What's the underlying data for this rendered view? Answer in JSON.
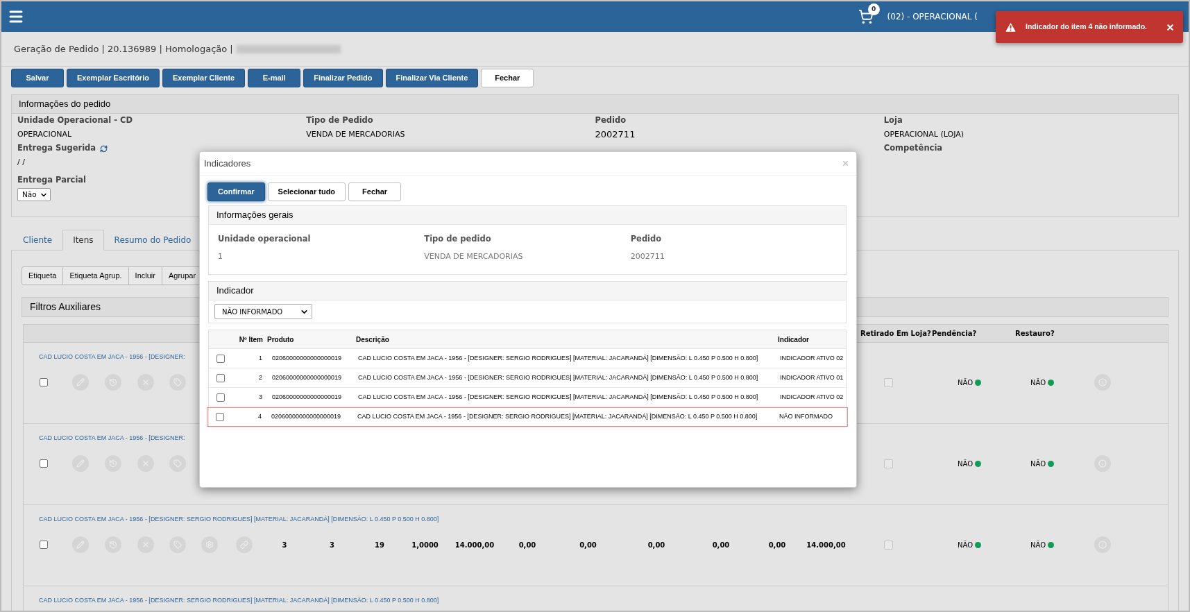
{
  "topbar": {
    "cart_count": "0",
    "user": "(02) - OPERACIONAL ("
  },
  "toast": {
    "message": "Indicador do item 4 não informado."
  },
  "page_title": "Geração de Pedido | 20.136989 | Homologação |",
  "actions": [
    {
      "label": "Salvar",
      "kind": "primary"
    },
    {
      "label": "Exemplar Escritório",
      "kind": "primary"
    },
    {
      "label": "Exemplar Cliente",
      "kind": "primary"
    },
    {
      "label": "E-mail",
      "kind": "primary"
    },
    {
      "label": "Finalizar Pedido",
      "kind": "primary"
    },
    {
      "label": "Finalizar Via Cliente",
      "kind": "primary"
    },
    {
      "label": "Fechar",
      "kind": "default"
    }
  ],
  "order_info": {
    "title": "Informações do pedido",
    "columns": [
      [
        {
          "label": "Unidade Operacional - CD",
          "value": "OPERACIONAL",
          "kind": "text"
        },
        {
          "label": "Entrega Sugerida",
          "value": "/ /",
          "kind": "refresh"
        },
        {
          "label": "Entrega Parcial",
          "value": "Não",
          "kind": "select"
        }
      ],
      [
        {
          "label": "Tipo de Pedido",
          "value": "VENDA DE MERCADORIAS",
          "kind": "text"
        }
      ],
      [
        {
          "label": "Pedido",
          "value": "2002711",
          "kind": "large"
        }
      ],
      [
        {
          "label": "Loja",
          "value": "OPERACIONAL (LOJA)",
          "kind": "text"
        },
        {
          "label": "Competência",
          "kind": "text"
        }
      ]
    ]
  },
  "tabs": [
    {
      "label": "Cliente",
      "selected": false
    },
    {
      "label": "Itens",
      "selected": true
    },
    {
      "label": "Resumo do Pedido",
      "selected": false
    }
  ],
  "items_toolbar": [
    "Etiqueta",
    "Etiqueta Agrup.",
    "Incluir",
    "Agrupar"
  ],
  "filters": {
    "title": "Filtros Auxiliares"
  },
  "items_table": {
    "columns": [
      "Retirado Em Loja?",
      "Pendência?",
      "Restauro?"
    ],
    "rows": [
      {
        "kind": "partial",
        "title": "CAD LUCIO COSTA EM JACA - 1956 - [DESIGNER:",
        "checked": false,
        "picked_up": false,
        "pendencia": {
          "text": "NÃO",
          "color": "#119c55"
        },
        "restauro": {
          "text": "NÃO",
          "color": "#119c55"
        }
      },
      {
        "kind": "partial",
        "title": "CAD LUCIO COSTA EM JACA - 1956 - [DESIGNER:",
        "checked": false,
        "picked_up": false,
        "pendencia": {
          "text": "NÃO",
          "color": "#119c55"
        },
        "restauro": {
          "text": "NÃO",
          "color": "#119c55"
        }
      },
      {
        "kind": "full",
        "title": "CAD LUCIO COSTA EM JACA - 1956 - [DESIGNER: SERGIO RODRIGUES] [MATERIAL: JACARANDÁ] [DIMENSÃO: L 0.450 P 0.500 H 0.800]",
        "checked": false,
        "picked_up": false,
        "values": [
          "3",
          "3",
          "19",
          "1,0000",
          "14.000,00",
          "0,00",
          "0,00",
          "0,00",
          "0,00",
          "0,00",
          "14.000,00"
        ],
        "pendencia": {
          "text": "NÃO",
          "color": "#119c55"
        },
        "restauro": {
          "text": "NÃO",
          "color": "#119c55"
        }
      },
      {
        "kind": "title_only",
        "title": "CAD LUCIO COSTA EM JACA - 1956 - [DESIGNER: SERGIO RODRIGUES] [MATERIAL: JACARANDÁ] [DIMENSÃO: L 0.450 P 0.500 H 0.800]"
      }
    ]
  },
  "modal": {
    "title": "Indicadores",
    "buttons": [
      {
        "label": "Confirmar",
        "kind": "primary"
      },
      {
        "label": "Selecionar tudo",
        "kind": "default"
      },
      {
        "label": "Fechar",
        "kind": "default"
      }
    ],
    "general": {
      "title": "Informações gerais",
      "fields": [
        {
          "label": "Unidade operacional",
          "value": "1"
        },
        {
          "label": "Tipo de pedido",
          "value": "VENDA DE MERCADORIAS"
        },
        {
          "label": "Pedido",
          "value": "2002711"
        }
      ]
    },
    "indicator": {
      "title": "Indicador",
      "value": "NÃO INFORMADO"
    },
    "table": {
      "columns": [
        "Nº Item",
        "Produto",
        "Descrição",
        "Indicador"
      ],
      "rows": [
        {
          "checked": false,
          "highlighted": false,
          "item": "1",
          "product": "02060000000000000019",
          "description": "CAD LUCIO COSTA EM JACA - 1956 - [DESIGNER: SERGIO RODRIGUES] [MATERIAL: JACARANDÁ] [DIMENSÃO: L 0.450 P 0.500 H 0.800]",
          "indicator": "INDICADOR ATIVO 02"
        },
        {
          "checked": false,
          "highlighted": false,
          "item": "2",
          "product": "02060000000000000019",
          "description": "CAD LUCIO COSTA EM JACA - 1956 - [DESIGNER: SERGIO RODRIGUES] [MATERIAL: JACARANDÁ] [DIMENSÃO: L 0.450 P 0.500 H 0.800]",
          "indicator": "INDICADOR ATIVO 01"
        },
        {
          "checked": false,
          "highlighted": false,
          "item": "3",
          "product": "02060000000000000019",
          "description": "CAD LUCIO COSTA EM JACA - 1956 - [DESIGNER: SERGIO RODRIGUES] [MATERIAL: JACARANDÁ] [DIMENSÃO: L 0.450 P 0.500 H 0.800]",
          "indicator": "INDICADOR ATIVO 02"
        },
        {
          "checked": false,
          "highlighted": true,
          "item": "4",
          "product": "02060000000000000019",
          "description": "CAD LUCIO COSTA EM JACA - 1956 - [DESIGNER: SERGIO RODRIGUES] [MATERIAL: JACARANDÁ] [DIMENSÃO: L 0.450 P 0.500 H 0.800]",
          "indicator": "NÃO INFORMADO"
        }
      ]
    }
  }
}
